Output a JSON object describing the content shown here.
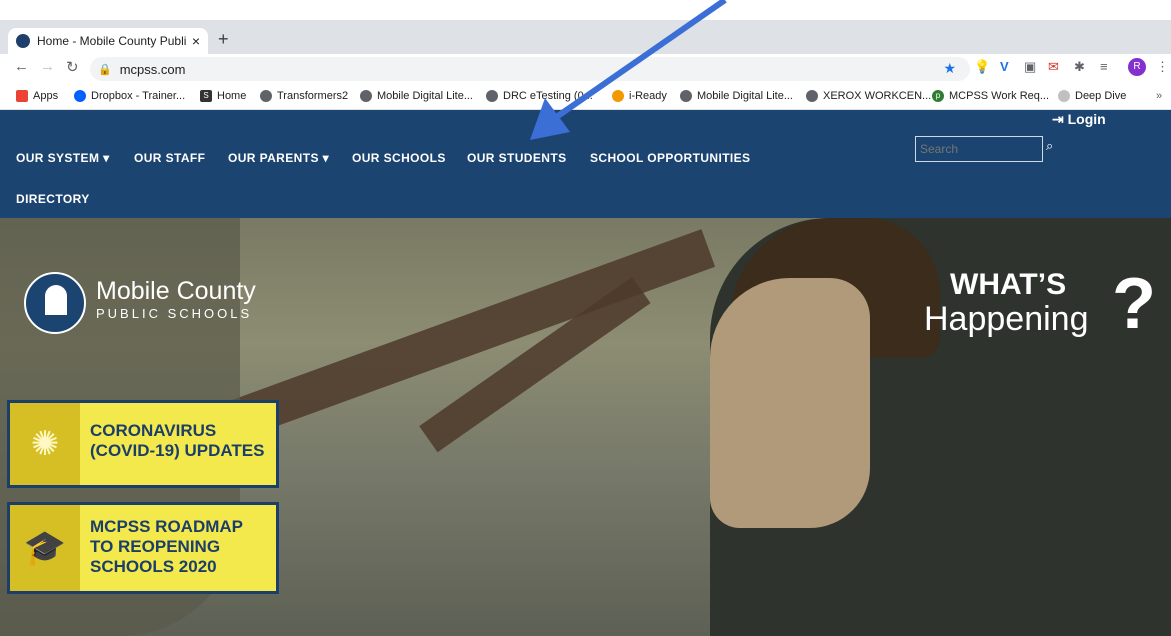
{
  "browser": {
    "tab_title": "Home - Mobile County Public S",
    "url": "mcpss.com",
    "profile_initial": "R",
    "bookmarks": [
      "Apps",
      "Dropbox - Trainer...",
      "Home",
      "Transformers2",
      "Mobile Digital Lite...",
      "DRC eTesting (0...",
      "i-Ready",
      "Mobile Digital Lite...",
      "XEROX WORKCEN...",
      "MCPSS Work Req...",
      "Deep Dive"
    ]
  },
  "site": {
    "nav": [
      "OUR SYSTEM ▾",
      "OUR STAFF",
      "OUR PARENTS ▾",
      "OUR SCHOOLS",
      "OUR STUDENTS",
      "SCHOOL OPPORTUNITIES",
      "DIRECTORY"
    ],
    "login": "Login",
    "search_placeholder": "Search",
    "logo_line1": "Mobile County",
    "logo_line2": "PUBLIC SCHOOLS",
    "whats_line1": "WHAT’S",
    "whats_line2": "Happening",
    "cards": [
      {
        "line1": "CORONAVIRUS",
        "line2": "(COVID-19) UPDATES",
        "icon": "virus-icon"
      },
      {
        "line1": "MCPSS ROADMAP",
        "line2": "TO REOPENING",
        "line3": "SCHOOLS 2020",
        "icon": "graduation-cap-icon"
      }
    ]
  },
  "colors": {
    "site_blue": "#1c4470",
    "card_yellow": "#f3e84c",
    "annotation_arrow": "#3b6fd6"
  }
}
